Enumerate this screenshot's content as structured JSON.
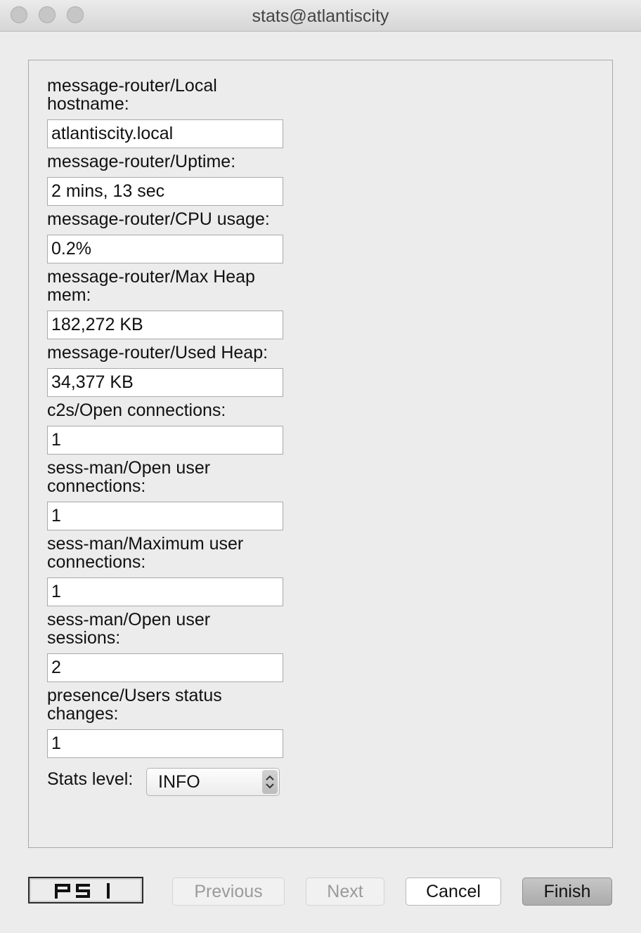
{
  "window": {
    "title": "stats@atlantiscity"
  },
  "stats": [
    {
      "label": "message-router/Local hostname:",
      "value": "atlantiscity.local"
    },
    {
      "label": "message-router/Uptime:",
      "value": "2 mins, 13 sec"
    },
    {
      "label": "message-router/CPU usage:",
      "value": "0.2%"
    },
    {
      "label": "message-router/Max Heap mem:",
      "value": "182,272 KB"
    },
    {
      "label": "message-router/Used Heap:",
      "value": "34,377 KB"
    },
    {
      "label": "c2s/Open connections:",
      "value": "1"
    },
    {
      "label": "sess-man/Open user connections:",
      "value": "1"
    },
    {
      "label": "sess-man/Maximum user connections:",
      "value": "1"
    },
    {
      "label": "sess-man/Open user sessions:",
      "value": "2"
    },
    {
      "label": "presence/Users status changes:",
      "value": "1"
    }
  ],
  "stats_level": {
    "label": "Stats level:",
    "value": "INFO"
  },
  "footer": {
    "logo_text": "PSI",
    "previous": "Previous",
    "next": "Next",
    "cancel": "Cancel",
    "finish": "Finish"
  }
}
